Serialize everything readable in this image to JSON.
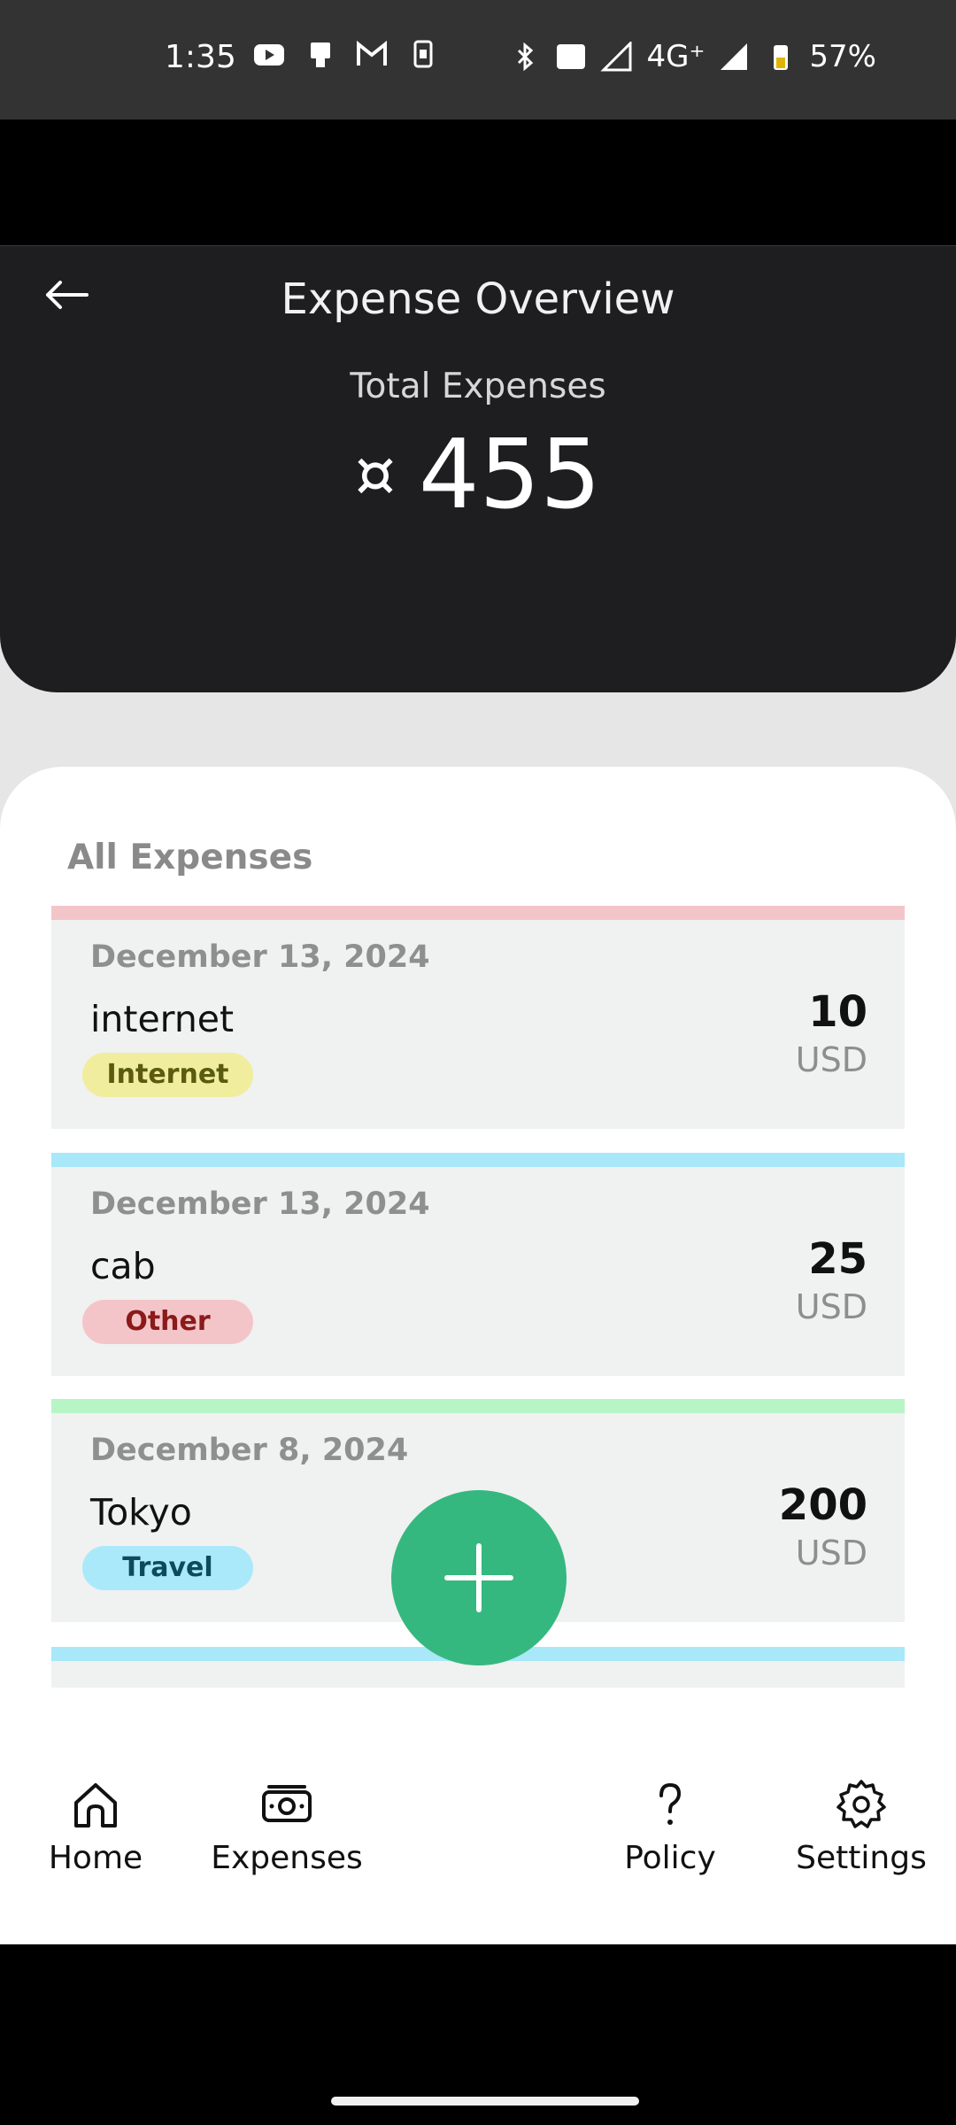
{
  "status_bar": {
    "time": "1:35",
    "network": "4G⁺",
    "battery": "57%",
    "icons_left": [
      "youtube-icon",
      "device-icon",
      "gmail-icon",
      "sim-icon"
    ],
    "icons_right": [
      "bluetooth-icon",
      "volte-icon",
      "signal-icon",
      "signal-icon",
      "battery-icon"
    ]
  },
  "header": {
    "title": "Expense Overview",
    "total_label": "Total Expenses",
    "currency_symbol": "¤",
    "total_value": "455"
  },
  "section": {
    "title": "All Expenses"
  },
  "expenses": [
    {
      "date": "December 13, 2024",
      "name": "internet",
      "category": "Internet",
      "amount": "10",
      "currency": "USD",
      "stripe_color": "#f4c5c8",
      "tag_bg": "#f0ee9e",
      "tag_color": "#5a5a10"
    },
    {
      "date": "December 13, 2024",
      "name": "cab",
      "category": "Other",
      "amount": "25",
      "currency": "USD",
      "stripe_color": "#a8e8f8",
      "tag_bg": "#f4c5c8",
      "tag_color": "#8b1a1a"
    },
    {
      "date": "December 8, 2024",
      "name": "Tokyo",
      "category": "Travel",
      "amount": "200",
      "currency": "USD",
      "stripe_color": "#b8f5c6",
      "tag_bg": "#a9e9fa",
      "tag_color": "#0d4a5c"
    }
  ],
  "partial_stripe_color": "#a8e8f8",
  "nav": {
    "home": "Home",
    "expenses": "Expenses",
    "policy": "Policy",
    "settings": "Settings"
  },
  "colors": {
    "fab": "#35b87f",
    "header_bg": "#1e1e20"
  }
}
